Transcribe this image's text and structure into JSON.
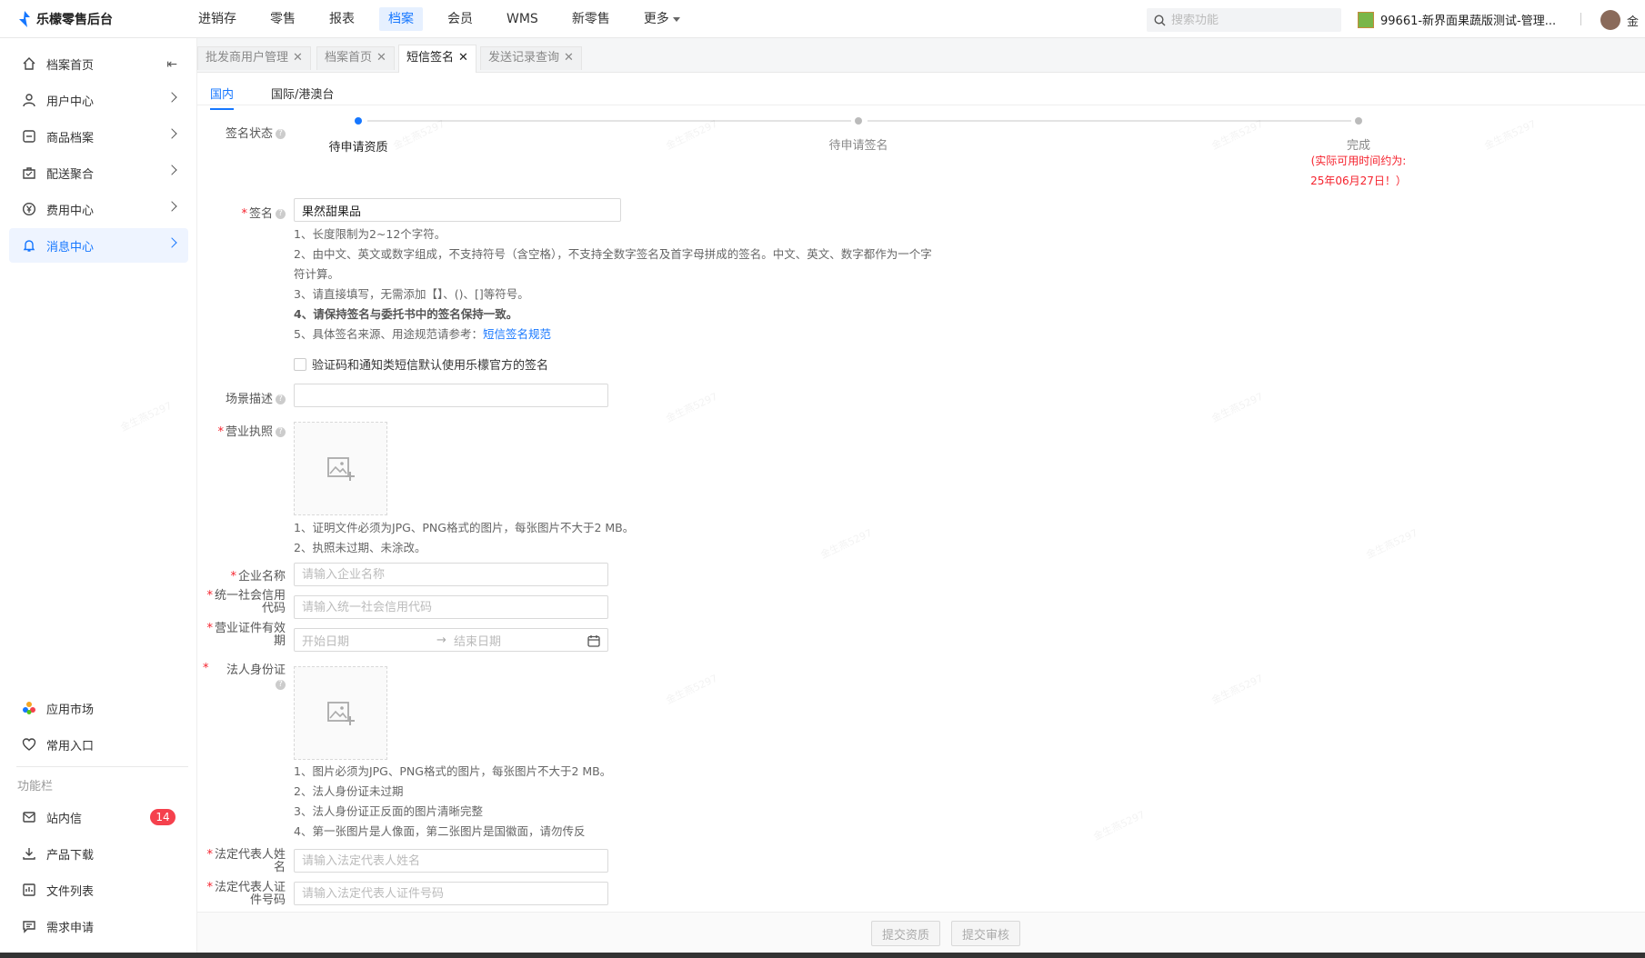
{
  "app": {
    "title": "乐檬零售后台",
    "nav": [
      "进销存",
      "零售",
      "报表",
      "档案",
      "会员",
      "WMS",
      "新零售",
      "更多"
    ],
    "active_nav": "档案",
    "search_placeholder": "搜索功能",
    "store_name": "99661-新界面果蔬版测试-管理...",
    "user_name": "金"
  },
  "sidebar": {
    "items": [
      {
        "label": "档案首页",
        "icon": "home-icon"
      },
      {
        "label": "用户中心",
        "icon": "user-icon"
      },
      {
        "label": "商品档案",
        "icon": "goods-icon"
      },
      {
        "label": "配送聚合",
        "icon": "delivery-icon"
      },
      {
        "label": "费用中心",
        "icon": "yen-icon"
      },
      {
        "label": "消息中心",
        "icon": "bell-icon"
      }
    ],
    "bottom_items": [
      {
        "label": "应用市场",
        "icon": "app-market-icon"
      },
      {
        "label": "常用入口",
        "icon": "heart-icon"
      }
    ],
    "group_label": "功能栏",
    "tool_items": [
      {
        "label": "站内信",
        "icon": "mail-icon",
        "badge": "14"
      },
      {
        "label": "产品下载",
        "icon": "download-icon"
      },
      {
        "label": "文件列表",
        "icon": "file-list-icon"
      },
      {
        "label": "需求申请",
        "icon": "request-icon"
      }
    ]
  },
  "tabs": [
    {
      "label": "批发商用户管理"
    },
    {
      "label": "档案首页"
    },
    {
      "label": "短信签名"
    },
    {
      "label": "发送记录查询"
    }
  ],
  "subtabs": [
    "国内",
    "国际/港澳台"
  ],
  "form": {
    "status_label": "签名状态",
    "steps": [
      "待申请资质",
      "待申请签名",
      "完成"
    ],
    "step_note_line1": "(实际可用时间约为:",
    "step_note_line2": "25年06月27日！）",
    "sign_label": "签名",
    "sign_value": "果然甜果品",
    "sign_hints": [
      "1、长度限制为2~12个字符。",
      "2、由中文、英文或数字组成，不支持符号（含空格），不支持全数字签名及首字母拼成的签名。中文、英文、数字都作为一个字",
      "符计算。",
      "3、请直接填写，无需添加【】、()、[]等符号。",
      "4、请保持签名与委托书中的签名保持一致。",
      "5、具体签名来源、用途规范请参考："
    ],
    "sign_link": "短信签名规范",
    "checkbox_label": "验证码和通知类短信默认使用乐檬官方的签名",
    "scene_label": "场景描述",
    "license_label": "营业执照",
    "license_hints": [
      "1、证明文件必须为JPG、PNG格式的图片，每张图片不大于2 MB。",
      "2、执照未过期、未涂改。"
    ],
    "company_label": "企业名称",
    "company_placeholder": "请输入企业名称",
    "credit_label_1": "统一社会信用",
    "credit_label_2": "代码",
    "credit_placeholder": "请输入统一社会信用代码",
    "validity_label_1": "营业证件有效",
    "validity_label_2": "期",
    "start_placeholder": "开始日期",
    "end_placeholder": "结束日期",
    "idcard_label": "法人身份证",
    "idcard_hints": [
      "1、图片必须为JPG、PNG格式的图片，每张图片不大于2 MB。",
      "2、法人身份证未过期",
      "3、法人身份证正反面的图片清晰完整",
      "4、第一张图片是人像面，第二张图片是国徽面，请勿传反"
    ],
    "rep_name_label_1": "法定代表人姓",
    "rep_name_label_2": "名",
    "rep_name_placeholder": "请输入法定代表人姓名",
    "rep_id_label_1": "法定代表人证",
    "rep_id_label_2": "件号码",
    "rep_id_placeholder": "请输入法定代表人证件号码"
  },
  "buttons": {
    "submit_qualification": "提交资质",
    "submit_review": "提交审核"
  },
  "watermark": "金生燕5297",
  "colors": {
    "accent": "#1677ff",
    "danger": "#f5222d",
    "badge": "#f5414d"
  }
}
